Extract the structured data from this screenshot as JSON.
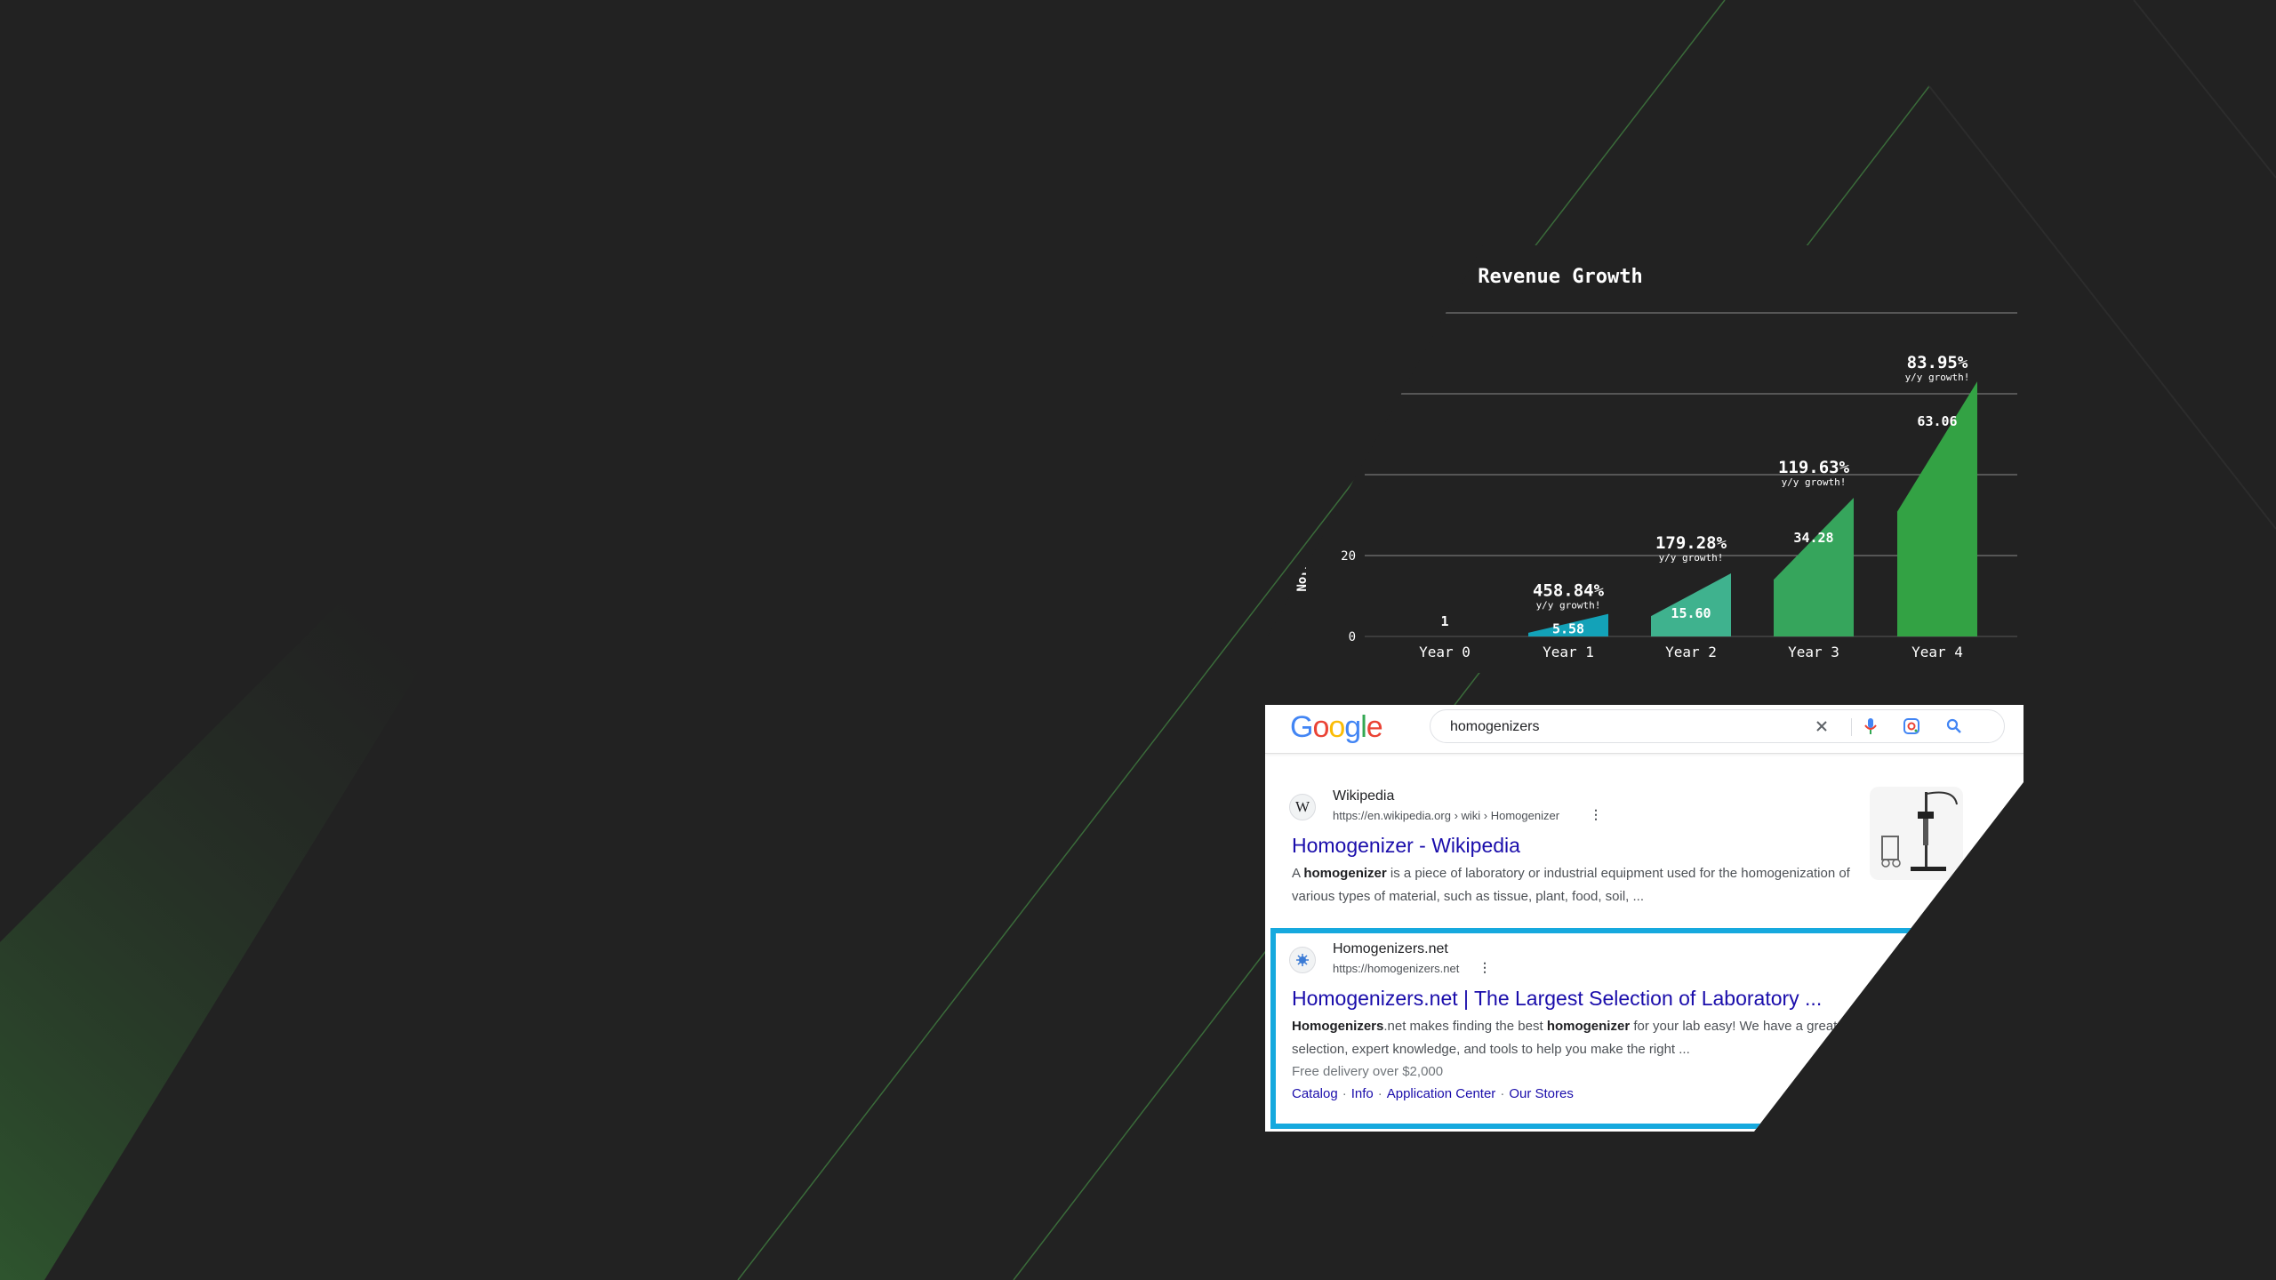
{
  "colors": {
    "background": "#222222",
    "bar_year1": "#13a2b8",
    "bar_year2": "#3fb28e",
    "bar_year3": "#36a55c",
    "bar_year4": "#33a244",
    "highlight_border": "#16a9de",
    "link": "#1a0dab"
  },
  "chart_data": {
    "type": "bar",
    "title": "Revenue Growth",
    "ylabel": "Normali",
    "categories": [
      "Year 0",
      "Year 1",
      "Year 2",
      "Year 3",
      "Year 4"
    ],
    "values": [
      1,
      5.58,
      15.6,
      34.28,
      63.06
    ],
    "value_labels": [
      "1",
      "5.58",
      "15.60",
      "34.28",
      "63.06"
    ],
    "growth": [
      null,
      "458.84%",
      "179.28%",
      "119.63%",
      "83.95%"
    ],
    "growth_note": "y/y growth!",
    "yticks": [
      0,
      20
    ],
    "ytick_labels": [
      "0",
      "20"
    ],
    "ylim": [
      0,
      80
    ],
    "gridlines": [
      20,
      40,
      60,
      80
    ],
    "grid": true
  },
  "serp": {
    "logo": "Google",
    "query": "homogenizers",
    "icons": [
      "clear-icon",
      "mic-icon",
      "lens-icon",
      "search-icon"
    ],
    "results": [
      {
        "site": "Wikipedia",
        "url": "https://en.wikipedia.org › wiki › Homogenizer",
        "title": "Homogenizer - Wikipedia",
        "snippet_html": "A <b>homogenizer</b> is a piece of laboratory or industrial equipment used for the homogenization of various types of material, such as tissue, plant, food, soil, ..."
      },
      {
        "site": "Homogenizers.net",
        "url": "https://homogenizers.net",
        "title": "Homogenizers.net | The Largest Selection of Laboratory ...",
        "snippet_html": "<b>Homogenizers</b>.net makes finding the best <b>homogenizer</b> for your lab easy! We have a great selection, expert knowledge, and tools to help you make the right ...",
        "extra": "Free delivery over $2,000",
        "sitelinks": [
          "Catalog",
          "Info",
          "Application Center",
          "Our Stores"
        ]
      }
    ]
  }
}
